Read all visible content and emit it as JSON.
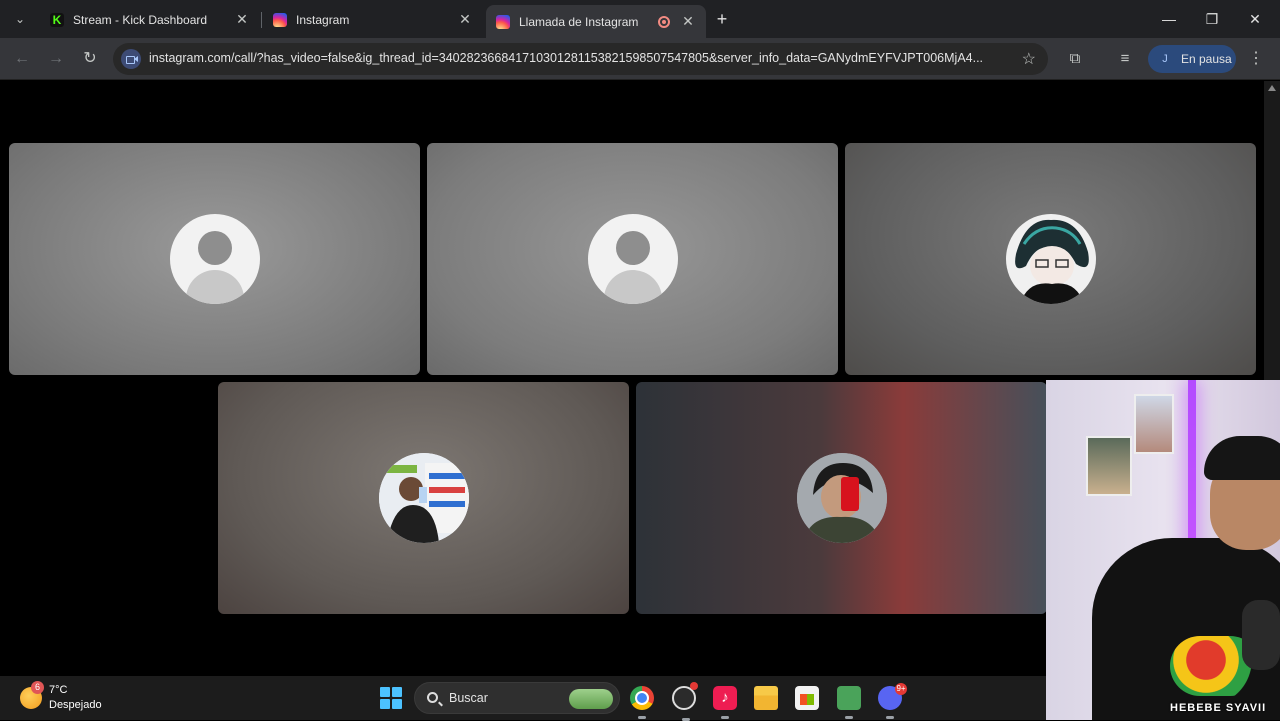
{
  "browser": {
    "tabs": [
      {
        "title": "Stream - Kick Dashboard",
        "favicon": "kick-icon",
        "active": false
      },
      {
        "title": "Instagram",
        "favicon": "instagram-icon",
        "active": false
      },
      {
        "title": "Llamada de Instagram",
        "favicon": "instagram-icon",
        "active": true,
        "recording": true
      }
    ],
    "new_tab_label": "+",
    "kick_logo_letter": "K",
    "url": "instagram.com/call/?has_video=false&ig_thread_id=340282366841710301281153821598507547805&server_info_data=GANydmEYFVJPT006MjA4...",
    "profile": {
      "initial": "J",
      "status": "En pausa"
    },
    "accent": "#a8c7fa"
  },
  "call": {
    "participants": [
      {
        "avatar": "default-avatar",
        "bg": "#8f8f8f"
      },
      {
        "avatar": "default-avatar",
        "bg": "#8c8c8c"
      },
      {
        "avatar": "anime-avatar",
        "bg": "#6f6f6f"
      },
      {
        "avatar": "photo-avatar-store",
        "bg": "#6e6763"
      },
      {
        "avatar": "photo-avatar-phone",
        "bg": "#5f4a4c"
      }
    ]
  },
  "webcam": {
    "shirt_text": "HEBEBE SYAVII"
  },
  "taskbar": {
    "weather": {
      "badge": "6",
      "temp": "7°C",
      "desc": "Despejado"
    },
    "search_label": "Buscar",
    "tiktok_glyph": "♪",
    "discord_badge": "9+"
  }
}
